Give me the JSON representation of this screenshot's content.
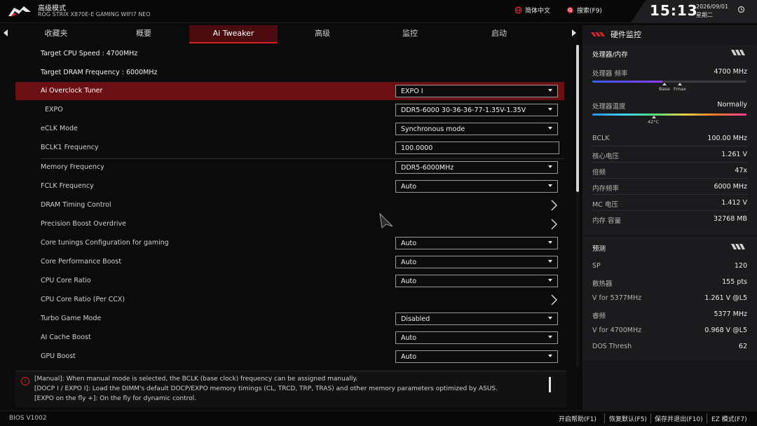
{
  "header": {
    "mode_title": "高级模式",
    "board_model": "ROG STRIX X870E-E GAMING WIFI7 NEO",
    "language_label": "简体中文",
    "search_label": "搜索(F9)",
    "time": "15:13",
    "date": "2026/09/01",
    "weekday": "星期二"
  },
  "tabs": [
    {
      "label": "收藏夹"
    },
    {
      "label": "概要"
    },
    {
      "label": "Ai Tweaker",
      "active": true
    },
    {
      "label": "高级"
    },
    {
      "label": "监控"
    },
    {
      "label": "启动"
    }
  ],
  "settings": [
    {
      "label": "Target CPU Speed : 4700MHz"
    },
    {
      "label": "Target DRAM Frequency : 6000MHz"
    },
    {
      "label": "Ai Overclock Tuner",
      "value": "EXPO I"
    },
    {
      "label": "EXPO",
      "value": "DDR5-6000 30-36-36-77-1.35V-1.35V"
    },
    {
      "label": "eCLK Mode",
      "value": "Synchronous mode"
    },
    {
      "label": "BCLK1 Frequency",
      "value": "100.0000"
    },
    {
      "label": "Memory Frequency",
      "value": "DDR5-6000MHz"
    },
    {
      "label": "FCLK Frequency",
      "value": "Auto"
    },
    {
      "label": "DRAM Timing Control"
    },
    {
      "label": "Precision Boost Overdrive"
    },
    {
      "label": "Core tunings Configuration for gaming",
      "value": "Auto"
    },
    {
      "label": "Core Performance Boost",
      "value": "Auto"
    },
    {
      "label": "CPU Core Ratio",
      "value": "Auto"
    },
    {
      "label": "CPU Core Ratio (Per CCX)"
    },
    {
      "label": "Turbo Game Mode",
      "value": "Disabled"
    },
    {
      "label": "AI Cache Boost",
      "value": "Auto"
    },
    {
      "label": "GPU Boost",
      "value": "Auto"
    }
  ],
  "help": {
    "lines": [
      "[Manual]: When manual mode is selected, the BCLK (base clock) frequency can be assigned manually.",
      "[DOCP I / EXPO I]: Load the DIMM's default DOCP/EXPO memory timings (CL, TRCD, TRP, TRAS) and other memory parameters optimized by ASUS.",
      "[EXPO on the fly +]: On the fly for dynamic control."
    ]
  },
  "monitor": {
    "title": "硬件监控",
    "cpu_mem_title": "处理器/内存",
    "cpu_freq_label": "处理器 频率",
    "cpu_freq_value": "4700 MHz",
    "freq_marker_base": "Base",
    "freq_marker_fmax": "Fmax",
    "cpu_temp_label": "处理器温度",
    "cpu_temp_value": "Normally",
    "temp_marker": "42°C",
    "rows": [
      {
        "label": "BCLK",
        "value": "100.00 MHz"
      },
      {
        "label": "核心电压",
        "value": "1.261 V"
      },
      {
        "label": "倍频",
        "value": "47x"
      },
      {
        "label": "内存频率",
        "value": "6000 MHz"
      },
      {
        "label": "MC 电压",
        "value": "1.412 V"
      },
      {
        "label": "内存 容量",
        "value": "32768 MB"
      }
    ],
    "predict_title": "预测",
    "predict_rows": [
      {
        "label": "SP",
        "value": "120"
      },
      {
        "label": "散热器",
        "value": "155 pts"
      },
      {
        "label": "V for 5377MHz",
        "value": "1.261 V @L5"
      },
      {
        "label": "睿频",
        "value": "5377 MHz"
      },
      {
        "label": "V for 4700MHz",
        "value": "0.968 V @L5"
      },
      {
        "label": "DOS Thresh",
        "value": "62"
      }
    ]
  },
  "footer": {
    "bios_version": "BIOS V1002",
    "help_label": "开启帮助(F1)",
    "default_label": "恢复默认(F5)",
    "save_label": "保存并退出(F10)",
    "ez_label": "EZ 模式(F7)"
  },
  "colors": {
    "accent_red": "#d2232a",
    "selected_row": "#6a0f13",
    "active_tab": "#4b0c0f"
  }
}
